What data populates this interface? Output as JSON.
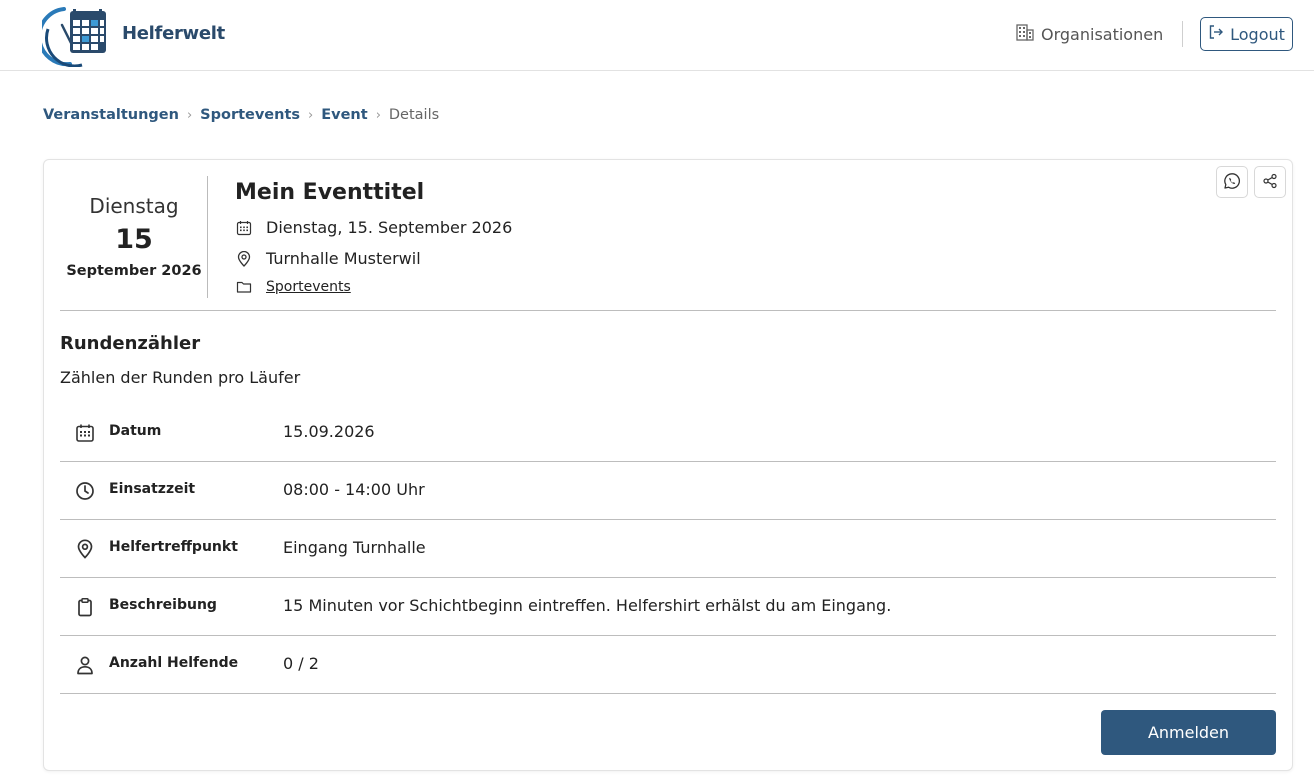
{
  "header": {
    "logo_text": "Helferwelt",
    "organisations_label": "Organisationen",
    "logout_label": "Logout"
  },
  "breadcrumb": {
    "items": [
      "Veranstaltungen",
      "Sportevents",
      "Event"
    ],
    "current": "Details",
    "separator": "›"
  },
  "event": {
    "weekday": "Dienstag",
    "day": "15",
    "month_year": "September 2026",
    "title": "Mein Eventtitel",
    "full_date": "Dienstag, 15. September 2026",
    "location": "Turnhalle Musterwil",
    "category": "Sportevents"
  },
  "shift": {
    "title": "Rundenzähler",
    "description": "Zählen der Runden pro Läufer",
    "details": [
      {
        "icon": "calendar-icon",
        "label": "Datum",
        "value": "15.09.2026"
      },
      {
        "icon": "clock-icon",
        "label": "Einsatzzeit",
        "value": "08:00 - 14:00 Uhr"
      },
      {
        "icon": "location-pin-icon",
        "label": "Helfertreffpunkt",
        "value": "Eingang Turnhalle"
      },
      {
        "icon": "clipboard-icon",
        "label": "Beschreibung",
        "value": "15 Minuten vor Schichtbeginn eintreffen. Helfershirt erhälst du am Eingang."
      },
      {
        "icon": "person-icon",
        "label": "Anzahl Helfende",
        "value": "0 / 2"
      }
    ]
  },
  "actions": {
    "signup_label": "Anmelden"
  },
  "colors": {
    "primary": "#2f587e",
    "border": "#bdbdbd",
    "text": "#222222"
  }
}
